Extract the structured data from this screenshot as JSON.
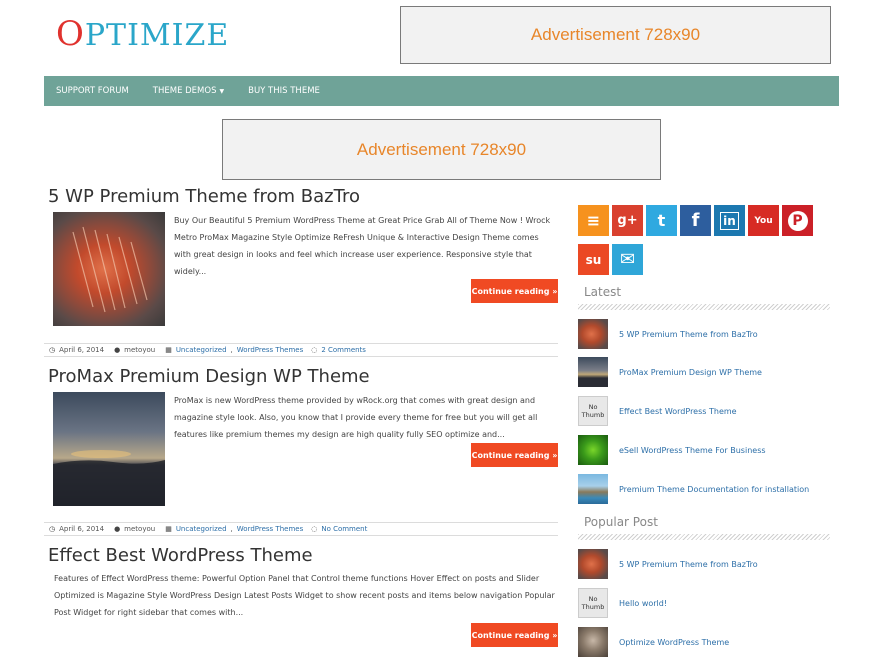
{
  "site": {
    "logo_first": "O",
    "logo_rest": "PTIMIZE"
  },
  "ads": {
    "top": "Advertisement 728x90",
    "middle": "Advertisement 728x90"
  },
  "nav": {
    "items": [
      {
        "label": "SUPPORT FORUM"
      },
      {
        "label": "THEME DEMOS",
        "caret": "▼"
      },
      {
        "label": "BUY THIS THEME"
      }
    ]
  },
  "posts": [
    {
      "title": "5 WP Premium Theme from BazTro",
      "excerpt": "Buy Our Beautiful 5 Premium WordPress Theme at Great Price Grab All of Theme Now ! Wrock Metro ProMax Magazine Style Optimize ReFresh  Unique & Interactive Design Theme comes with great design in looks and feel which increase user experience. Responsive style that widely...",
      "readmore": "Continue reading »",
      "date": "April 6, 2014",
      "author": "metoyou",
      "cat1": "Uncategorized",
      "cat2": "WordPress Themes",
      "comments": "2 Comments"
    },
    {
      "title": "ProMax Premium Design WP Theme",
      "excerpt": "ProMax is new WordPress theme provided by wRock.org that comes with great design and magazine style look. Also, you know that I provide every theme for free but you will get all features like premium themes my design are high quality fully SEO optimize and...",
      "readmore": "Continue reading »",
      "date": "April 6, 2014",
      "author": "metoyou",
      "cat1": "Uncategorized",
      "cat2": "WordPress Themes",
      "comments": "No Comment"
    },
    {
      "title": "Effect Best WordPress Theme",
      "excerpt": "  Features of Effect WordPress theme: Powerful Option Panel that Control theme functions Hover Effect on posts and Slider Optimized is Magazine Style WordPress Design Latest Posts Widget to show recent posts and items below navigation Popular Post Widget for right sidebar that comes with...",
      "readmore": "Continue reading »"
    }
  ],
  "social": [
    {
      "name": "rss",
      "glyph": "≡",
      "color": "#f6921e"
    },
    {
      "name": "google-plus",
      "glyph": "g+",
      "color": "#d9402e"
    },
    {
      "name": "twitter",
      "glyph": "t",
      "color": "#2fa9e0"
    },
    {
      "name": "facebook",
      "glyph": "f",
      "color": "#2d5e9e"
    },
    {
      "name": "linkedin",
      "glyph": "in",
      "color": "#1c78b0"
    },
    {
      "name": "youtube",
      "glyph": "You",
      "color": "#d72b24"
    },
    {
      "name": "pinterest",
      "glyph": "P",
      "color": "#cb2027"
    },
    {
      "name": "stumbleupon",
      "glyph": "su",
      "color": "#eb4924"
    },
    {
      "name": "email",
      "glyph": "✉",
      "color": "#2fa6d8"
    }
  ],
  "sidebar": {
    "latest_title": "Latest",
    "latest": [
      {
        "label": "5 WP Premium Theme from BazTro",
        "thumb": "rust"
      },
      {
        "label": "ProMax Premium Design WP Theme",
        "thumb": "sunset"
      },
      {
        "label": "Effect Best WordPress Theme",
        "thumb": "none"
      },
      {
        "label": "eSell WordPress Theme For Business",
        "thumb": "green"
      },
      {
        "label": "Premium Theme Documentation for installation",
        "thumb": "coast"
      }
    ],
    "popular_title": "Popular Post",
    "popular": [
      {
        "label": "5 WP Premium Theme from BazTro",
        "thumb": "rust"
      },
      {
        "label": "Hello world!",
        "thumb": "none"
      },
      {
        "label": "Optimize WordPress Theme",
        "thumb": "dog"
      }
    ],
    "no_thumb_line1": "No",
    "no_thumb_line2": "Thumb"
  }
}
